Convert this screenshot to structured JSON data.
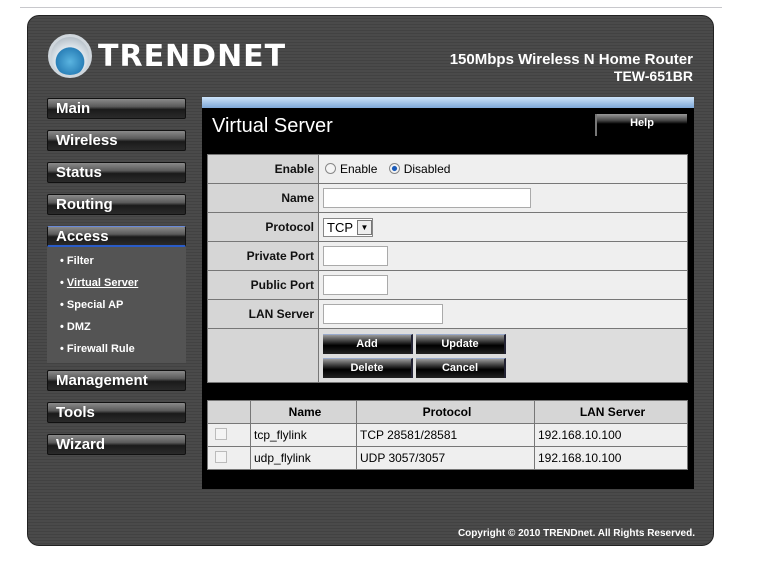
{
  "brand": {
    "logo_text": "TRENDnet",
    "product": "150Mbps Wireless N Home Router",
    "model": "TEW-651BR"
  },
  "nav": {
    "main": "Main",
    "wireless": "Wireless",
    "status": "Status",
    "routing": "Routing",
    "access": "Access",
    "management": "Management",
    "tools": "Tools",
    "wizard": "Wizard"
  },
  "submenu": [
    "Filter",
    "Virtual Server",
    "Special AP",
    "DMZ",
    "Firewall Rule"
  ],
  "page": {
    "title": "Virtual Server",
    "help": "Help"
  },
  "form": {
    "enable_label": "Enable",
    "opt_enable": "Enable",
    "opt_disabled": "Disabled",
    "enable_selected": "Disabled",
    "name_label": "Name",
    "name_value": "",
    "protocol_label": "Protocol",
    "protocol_value": "TCP",
    "private_port_label": "Private Port",
    "private_port_value": "",
    "public_port_label": "Public Port",
    "public_port_value": "",
    "lan_server_label": "LAN Server",
    "lan_server_value": "",
    "add": "Add",
    "update": "Update",
    "delete": "Delete",
    "cancel": "Cancel"
  },
  "table": {
    "headers": [
      "Name",
      "Protocol",
      "LAN Server"
    ],
    "rows": [
      {
        "name": "tcp_flylink",
        "protocol": "TCP 28581/28581",
        "lan": "192.168.10.100",
        "checked": false
      },
      {
        "name": "udp_flylink",
        "protocol": "UDP 3057/3057",
        "lan": "192.168.10.100",
        "checked": false
      }
    ]
  },
  "footer": {
    "copyright": "Copyright © 2010 TRENDnet. All Rights Reserved."
  },
  "colors": {
    "accent": "#2a5cc8",
    "frame": "#454545"
  }
}
